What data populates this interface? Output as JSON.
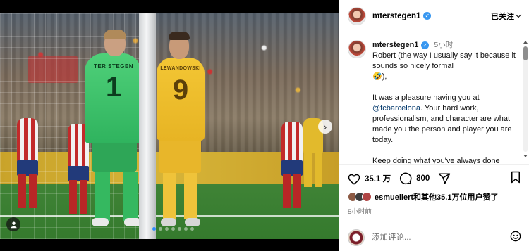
{
  "post": {
    "media": {
      "keeper_name": "TER STEGEN",
      "keeper_number": "1",
      "striker_name": "LEWANDOWSKI",
      "striker_number": "9",
      "carousel_dot_count": 7,
      "carousel_active_index": 0
    },
    "header": {
      "username": "mterstegen1",
      "follow_label": "已关注"
    },
    "caption": {
      "username": "mterstegen1",
      "time": "5小时",
      "line1": "Robert (the way I usually say it because it sounds so nicely formal",
      "line1_emoji": "🤣),",
      "para2_before": "It was a pleasure having you at ",
      "mention": "@fcbarcelona",
      "para2_after": ". Your hard work, professionalism, and character are what made you the person and player you are today.",
      "para3": "Keep doing what you've always done"
    },
    "actions": {
      "like_count": "35.1 万",
      "comment_count": "800"
    },
    "likes": {
      "user": "esmuellert",
      "rest": "和其他35.1万位用户赞了"
    },
    "timestamp": "5小时前",
    "comment_box": {
      "placeholder": "添加评论..."
    }
  },
  "colors": {
    "verified": "#3897f0",
    "mention": "#00376b",
    "carousel_active": "#2b8cff"
  }
}
